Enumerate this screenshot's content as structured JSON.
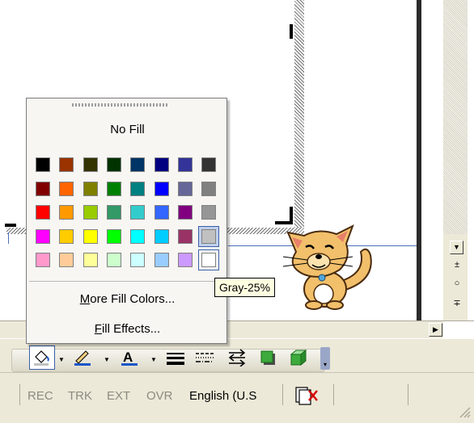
{
  "palette": {
    "no_fill_label": "No Fill",
    "more_colors_label": "More Fill Colors...",
    "more_colors_mnemonic": "M",
    "more_colors_rest": "ore Fill Colors...",
    "fill_effects_label": "Fill Effects...",
    "fill_effects_mnemonic": "F",
    "fill_effects_rest": "ill Effects...",
    "selected_color": "Gray-25%",
    "colors": [
      [
        "#000000",
        "#993300",
        "#333300",
        "#003300",
        "#003366",
        "#000080",
        "#333399",
        "#333333"
      ],
      [
        "#800000",
        "#FF6600",
        "#808000",
        "#008000",
        "#008080",
        "#0000FF",
        "#666699",
        "#808080"
      ],
      [
        "#FF0000",
        "#FF9900",
        "#99CC00",
        "#339966",
        "#33CCCC",
        "#3366FF",
        "#800080",
        "#969696"
      ],
      [
        "#FF00FF",
        "#FFCC00",
        "#FFFF00",
        "#00FF00",
        "#00FFFF",
        "#00CCFF",
        "#993366",
        "#C0C0C0"
      ],
      [
        "#FF99CC",
        "#FFCC99",
        "#FFFF99",
        "#CCFFCC",
        "#CCFFFF",
        "#99CCFF",
        "#CC99FF",
        "#FFFFFF"
      ]
    ]
  },
  "tooltip": {
    "text": "Gray-25%"
  },
  "statusbar": {
    "rec": "REC",
    "trk": "TRK",
    "ext": "EXT",
    "ovr": "OVR",
    "language": "English (U.S"
  },
  "toolbar": {
    "icons": [
      "fill-color-icon",
      "line-color-icon",
      "font-color-icon",
      "line-style-icon",
      "dash-style-icon",
      "arrow-style-icon",
      "shadow-icon",
      "3d-icon"
    ]
  },
  "scrollbar": {
    "nav_prev": "±",
    "nav_select": "○",
    "nav_next": "∓"
  }
}
